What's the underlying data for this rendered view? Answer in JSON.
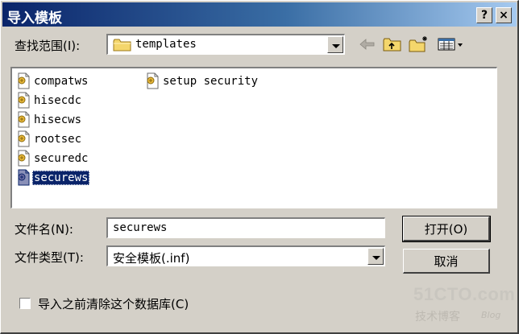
{
  "window": {
    "title": "导入模板",
    "help_button": "?",
    "close_button": "×"
  },
  "lookin": {
    "label": "查找范围(I):",
    "value": "templates"
  },
  "toolbar": {
    "back_icon": "back-arrow-icon",
    "up_icon": "up-folder-icon",
    "new_folder_icon": "new-folder-icon",
    "view_icon": "view-menu-icon"
  },
  "files": [
    {
      "name": "compatws"
    },
    {
      "name": "hisecdc"
    },
    {
      "name": "hisecws"
    },
    {
      "name": "rootsec"
    },
    {
      "name": "securedc"
    },
    {
      "name": "securews",
      "selected": true
    },
    {
      "name": "setup security"
    }
  ],
  "filename": {
    "label": "文件名(N):",
    "value": "securews"
  },
  "filetype": {
    "label": "文件类型(T):",
    "value": "安全模板(.inf)"
  },
  "buttons": {
    "open": "打开(O)",
    "cancel": "取消"
  },
  "clear_db": {
    "label": "导入之前清除这个数据库(C)",
    "checked": false
  },
  "watermark": {
    "site": "51CTO.com",
    "sub": "技术博客",
    "blog": "Blog"
  },
  "colors": {
    "title_start": "#0a246a",
    "title_end": "#a6caf0",
    "face": "#d4d0c8",
    "selection": "#0a246a"
  }
}
